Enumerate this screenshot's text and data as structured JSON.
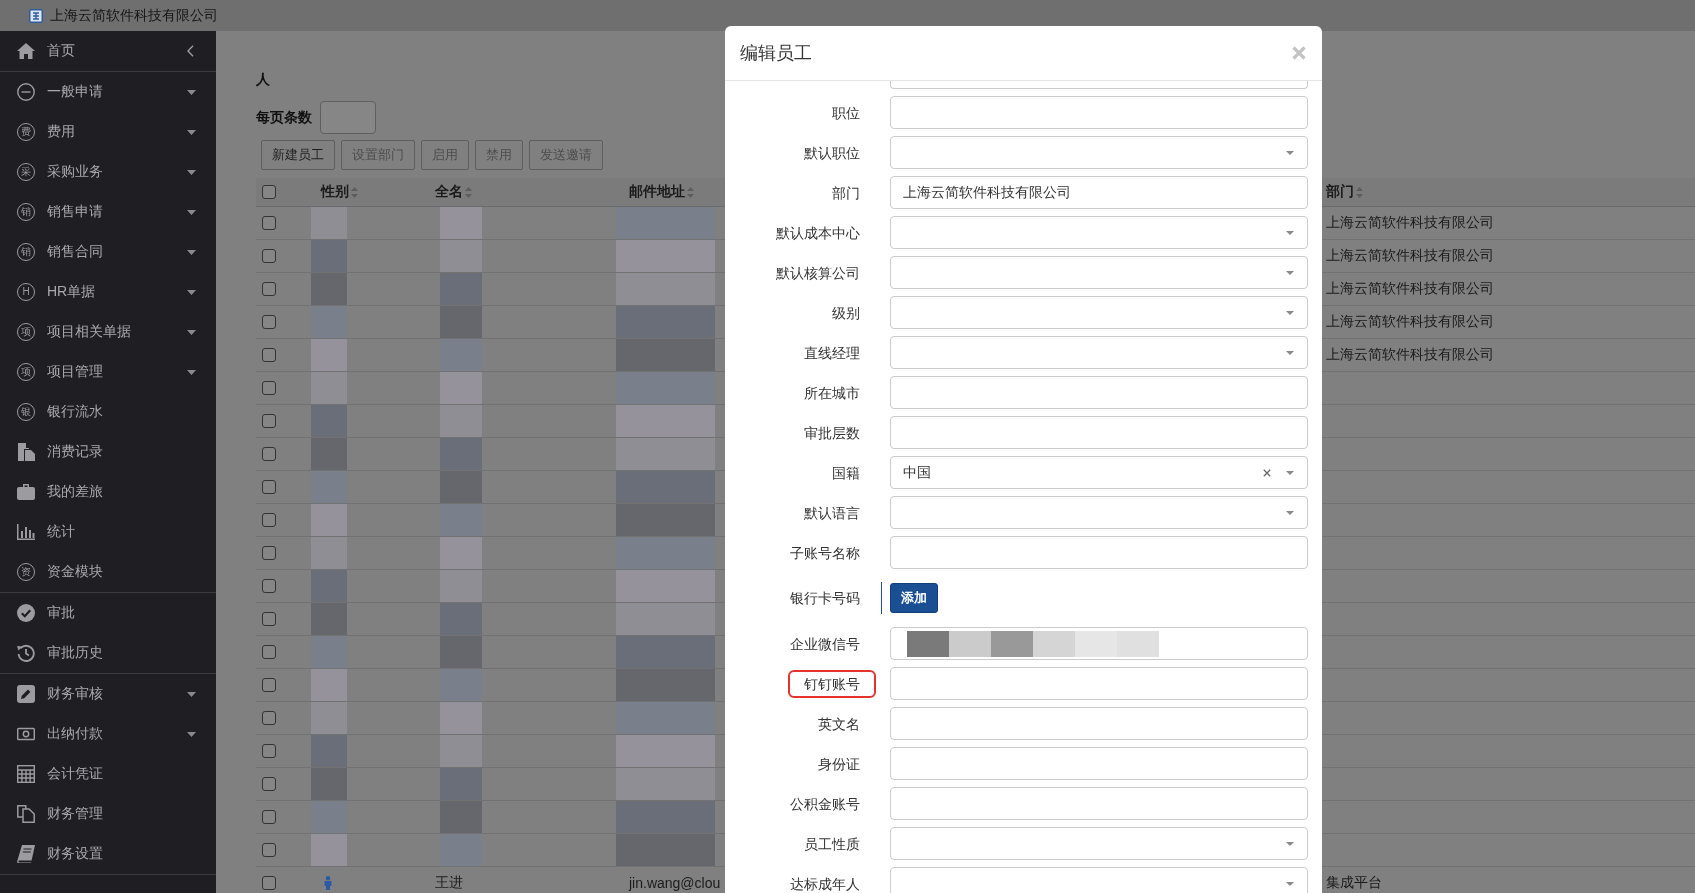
{
  "header": {
    "company": "上海云简软件科技有限公司"
  },
  "sidebar": {
    "groups": [
      {
        "items": [
          {
            "label": "首页",
            "kind": "home"
          }
        ]
      },
      {
        "items": [
          {
            "label": "一般申请",
            "kind": "submenu"
          },
          {
            "label": "费用",
            "kind": "submenu",
            "icon_text": "费"
          },
          {
            "label": "采购业务",
            "kind": "submenu",
            "icon_text": "采"
          },
          {
            "label": "销售申请",
            "kind": "submenu",
            "icon_text": "销"
          },
          {
            "label": "销售合同",
            "kind": "submenu",
            "icon_text": "销"
          },
          {
            "label": "HR单据",
            "kind": "submenu",
            "icon_text": "H"
          },
          {
            "label": "项目相关单据",
            "kind": "submenu",
            "icon_text": "项"
          },
          {
            "label": "项目管理",
            "kind": "submenu",
            "icon_text": "项"
          },
          {
            "label": "银行流水",
            "kind": "link",
            "icon_text": "银"
          },
          {
            "label": "消费记录",
            "kind": "link"
          },
          {
            "label": "我的差旅",
            "kind": "link"
          },
          {
            "label": "统计",
            "kind": "link"
          },
          {
            "label": "资金模块",
            "kind": "link",
            "icon_text": "资"
          }
        ]
      },
      {
        "items": [
          {
            "label": "审批",
            "kind": "link"
          },
          {
            "label": "审批历史",
            "kind": "link"
          }
        ]
      },
      {
        "items": [
          {
            "label": "财务审核",
            "kind": "submenu"
          },
          {
            "label": "出纳付款",
            "kind": "submenu"
          },
          {
            "label": "会计凭证",
            "kind": "link"
          },
          {
            "label": "财务管理",
            "kind": "link"
          },
          {
            "label": "财务设置",
            "kind": "link"
          }
        ]
      }
    ]
  },
  "toolbar": {
    "count_label": "人",
    "page_size_label": "每页条数",
    "buttons": [
      {
        "label": "新建员工",
        "disabled": false
      },
      {
        "label": "设置部门",
        "disabled": true
      },
      {
        "label": "启用",
        "disabled": true
      },
      {
        "label": "禁用",
        "disabled": true
      },
      {
        "label": "发送邀请",
        "disabled": true
      }
    ]
  },
  "table": {
    "header_checked": false,
    "columns": [
      "性别",
      "全名",
      "邮件地址",
      "部门"
    ],
    "rows": [
      {
        "checked": false,
        "redacted": true,
        "department": "上海云简软件科技有限公司"
      },
      {
        "checked": false,
        "redacted": true,
        "department": "上海云简软件科技有限公司"
      },
      {
        "checked": false,
        "redacted": true,
        "department": "上海云简软件科技有限公司"
      },
      {
        "checked": false,
        "redacted": true,
        "department": "上海云简软件科技有限公司"
      },
      {
        "checked": false,
        "redacted": true,
        "department": "上海云简软件科技有限公司"
      },
      {
        "checked": false,
        "redacted": true
      },
      {
        "checked": false,
        "redacted": true
      },
      {
        "checked": false,
        "redacted": true
      },
      {
        "checked": false,
        "redacted": true
      },
      {
        "checked": false,
        "redacted": true
      },
      {
        "checked": false,
        "redacted": true
      },
      {
        "checked": false,
        "redacted": true
      },
      {
        "checked": false,
        "redacted": true
      },
      {
        "checked": false,
        "redacted": true
      },
      {
        "checked": false,
        "redacted": true
      },
      {
        "checked": false,
        "redacted": true
      },
      {
        "checked": false,
        "redacted": true
      },
      {
        "checked": false,
        "redacted": true
      },
      {
        "checked": false,
        "redacted": true
      },
      {
        "checked": false,
        "redacted": true
      },
      {
        "checked": false,
        "redacted": false,
        "name": "王进",
        "email": "jin.wang@clou",
        "department": "集成平台"
      }
    ]
  },
  "modal": {
    "title": "编辑员工",
    "partial_field": {
      "kind": "input"
    },
    "fields": [
      {
        "label": "职位",
        "kind": "input",
        "highlighted": false,
        "redacted": false
      },
      {
        "label": "默认职位",
        "kind": "select",
        "highlighted": false,
        "redacted": false
      },
      {
        "label": "部门",
        "kind": "input",
        "value": "上海云简软件科技有限公司",
        "highlighted": false,
        "redacted": false
      },
      {
        "label": "默认成本中心",
        "kind": "select",
        "highlighted": false,
        "redacted": false
      },
      {
        "label": "默认核算公司",
        "kind": "select",
        "highlighted": false,
        "redacted": false
      },
      {
        "label": "级别",
        "kind": "select",
        "highlighted": false,
        "redacted": false
      },
      {
        "label": "直线经理",
        "kind": "select",
        "highlighted": false,
        "redacted": false
      },
      {
        "label": "所在城市",
        "kind": "input",
        "highlighted": false,
        "redacted": false
      },
      {
        "label": "审批层数",
        "kind": "input",
        "highlighted": false,
        "redacted": false
      },
      {
        "label": "国籍",
        "kind": "select",
        "value": "中国",
        "highlighted": false,
        "redacted": false
      },
      {
        "label": "默认语言",
        "kind": "select",
        "highlighted": false,
        "redacted": false
      },
      {
        "label": "子账号名称",
        "kind": "input",
        "highlighted": false,
        "redacted": false
      },
      {
        "label": "银行卡号码",
        "kind": "button",
        "button": "添加",
        "highlighted": false,
        "redacted": false
      },
      {
        "label": "企业微信号",
        "kind": "input",
        "highlighted": false,
        "redacted": true
      },
      {
        "label": "钉钉账号",
        "kind": "input",
        "highlighted": true,
        "redacted": false
      },
      {
        "label": "英文名",
        "kind": "input",
        "highlighted": false,
        "redacted": false
      },
      {
        "label": "身份证",
        "kind": "input",
        "highlighted": false,
        "redacted": false
      },
      {
        "label": "公积金账号",
        "kind": "input",
        "highlighted": false,
        "redacted": false
      },
      {
        "label": "员工性质",
        "kind": "select",
        "highlighted": false,
        "redacted": false
      },
      {
        "label": "达标成年人",
        "kind": "select",
        "highlighted": false,
        "redacted": false
      }
    ]
  }
}
